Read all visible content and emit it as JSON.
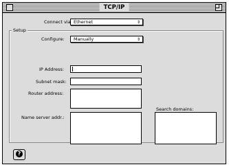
{
  "window": {
    "title": "TCP/IP"
  },
  "connect": {
    "label": "Connect via:",
    "value": "Ethernet"
  },
  "setup": {
    "group_label": "Setup",
    "configure_label": "Configure:",
    "configure_value": "Manually",
    "ip_label": "IP Address:",
    "subnet_label": "Subnet mask:",
    "router_label": "Router address:",
    "nameserver_label": "Name server addr.:",
    "search_label": "Search domains:"
  },
  "help": {
    "glyph": "?"
  }
}
